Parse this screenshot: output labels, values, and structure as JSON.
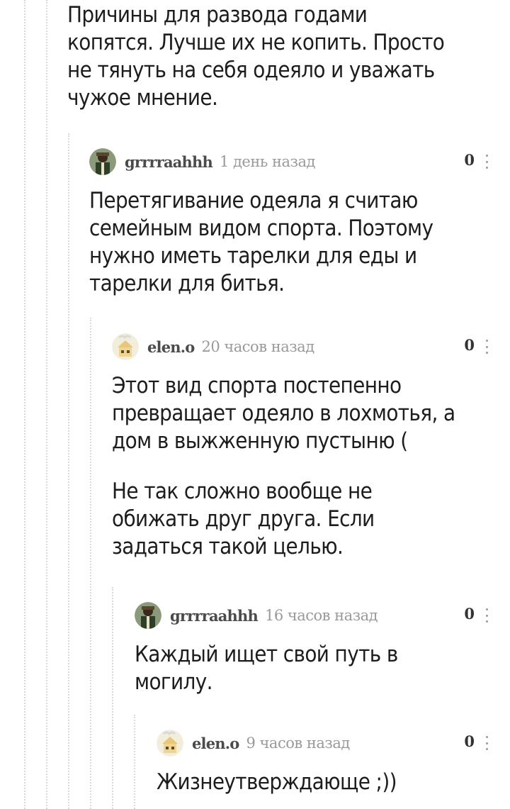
{
  "top_comment": {
    "text_lines": [
      "Причины для развода годами",
      "копятся. Лучше их не копить. Просто",
      "не тянуть на себя одеяло и уважать",
      "чужое мнение."
    ]
  },
  "comments": [
    {
      "author": "grrrraahhh",
      "time": "1 день назад",
      "rating": "0",
      "avatar_icon": "user-avatar-man-icon",
      "paragraphs": [
        [
          "Перетягивание одеяла я считаю",
          "семейным видом спорта. Поэтому",
          "нужно иметь тарелки для еды и",
          "тарелки для битья."
        ]
      ]
    },
    {
      "author": "elen.o",
      "time": "20 часов назад",
      "rating": "0",
      "avatar_icon": "user-avatar-house-icon",
      "paragraphs": [
        [
          "Этот вид спорта постепенно",
          "превращает одеяло в лохмотья, а",
          "дом в выжженную пустыню ("
        ],
        [
          "Не так сложно вообще не",
          "обижать друг друга. Если",
          "задаться такой целью."
        ]
      ]
    },
    {
      "author": "grrrraahhh",
      "time": "16 часов назад",
      "rating": "0",
      "avatar_icon": "user-avatar-man-icon",
      "paragraphs": [
        [
          "Каждый ищет свой путь в",
          "могилу."
        ]
      ]
    },
    {
      "author": "elen.o",
      "time": "9 часов назад",
      "rating": "0",
      "avatar_icon": "user-avatar-house-icon",
      "paragraphs": [
        [
          "Жизнеутверждающе ;))"
        ]
      ]
    }
  ],
  "colors": {
    "thread_line": "#dadada",
    "author": "#4b4b4b",
    "time": "#9a9a9a",
    "text": "#1d1d1d"
  }
}
